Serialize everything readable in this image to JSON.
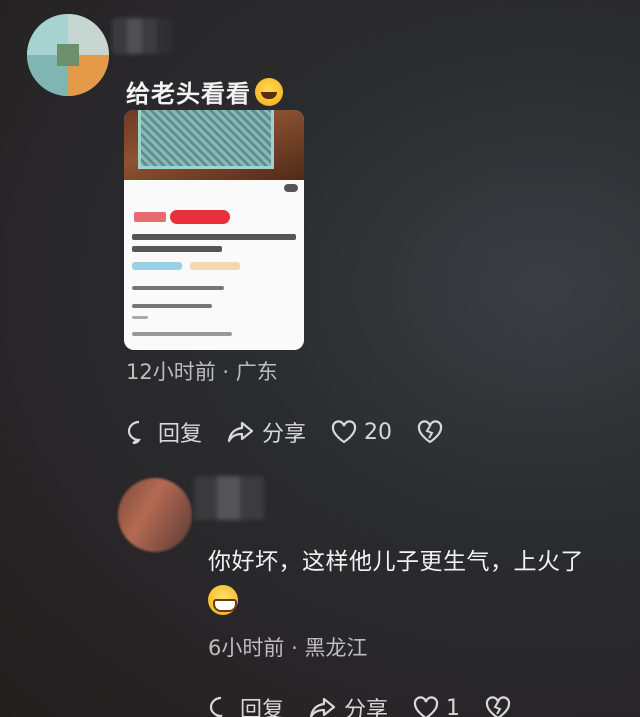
{
  "comment1": {
    "text": "给老头看看",
    "emoji": "laughing-crying-emoji",
    "time": "12小时前",
    "separator": "·",
    "location": "广东",
    "actions": {
      "reply": "回复",
      "share": "分享",
      "likes": "20"
    }
  },
  "comment2": {
    "text": "你好坏，这样他儿子更生气，上火了",
    "emoji": "grinning-emoji",
    "time": "6小时前",
    "separator": "·",
    "location": "黑龙江",
    "actions": {
      "reply": "回复",
      "share": "分享",
      "likes": "1"
    }
  },
  "colors": {
    "background": "#2b2c30",
    "text": "#f2f2f2",
    "meta": "#bdbdbd",
    "price_red": "#e8303a"
  }
}
